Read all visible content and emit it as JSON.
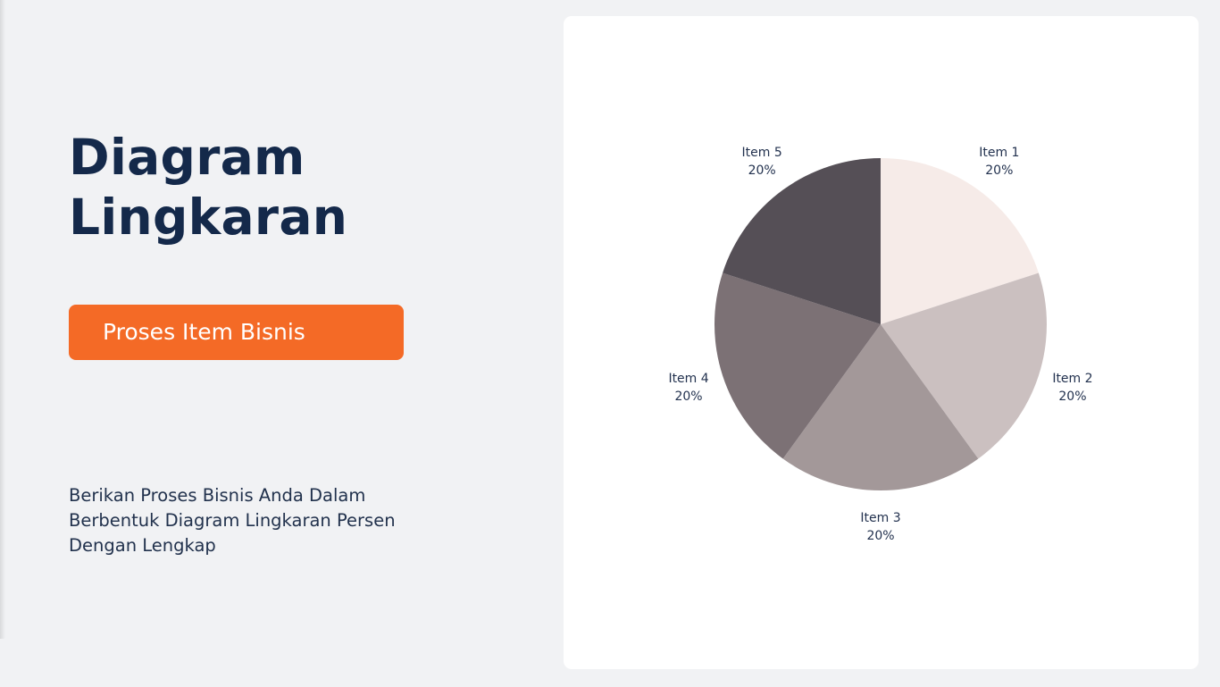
{
  "header": {
    "title_line1": "Diagram",
    "title_line2": "Lingkaran"
  },
  "cta": {
    "label": "Proses Item Bisnis"
  },
  "description": {
    "line1": "Berikan Proses Bisnis Anda Dalam",
    "line2": "Berbentuk Diagram Lingkaran Persen",
    "line3": "Dengan Lengkap"
  },
  "colors": {
    "background": "#f1f2f4",
    "title": "#14294a",
    "accent": "#f46a26",
    "card": "#ffffff"
  },
  "chart_data": {
    "type": "pie",
    "categories": [
      "Item 1",
      "Item 2",
      "Item 3",
      "Item 4",
      "Item 5"
    ],
    "values": [
      20,
      20,
      20,
      20,
      20
    ],
    "value_labels": [
      "20%",
      "20%",
      "20%",
      "20%",
      "20%"
    ],
    "colors": [
      "#f6ebe8",
      "#cbc0c0",
      "#a39899",
      "#7c7175",
      "#554f56"
    ],
    "start": "top",
    "direction": "clockwise",
    "legend": "none"
  }
}
